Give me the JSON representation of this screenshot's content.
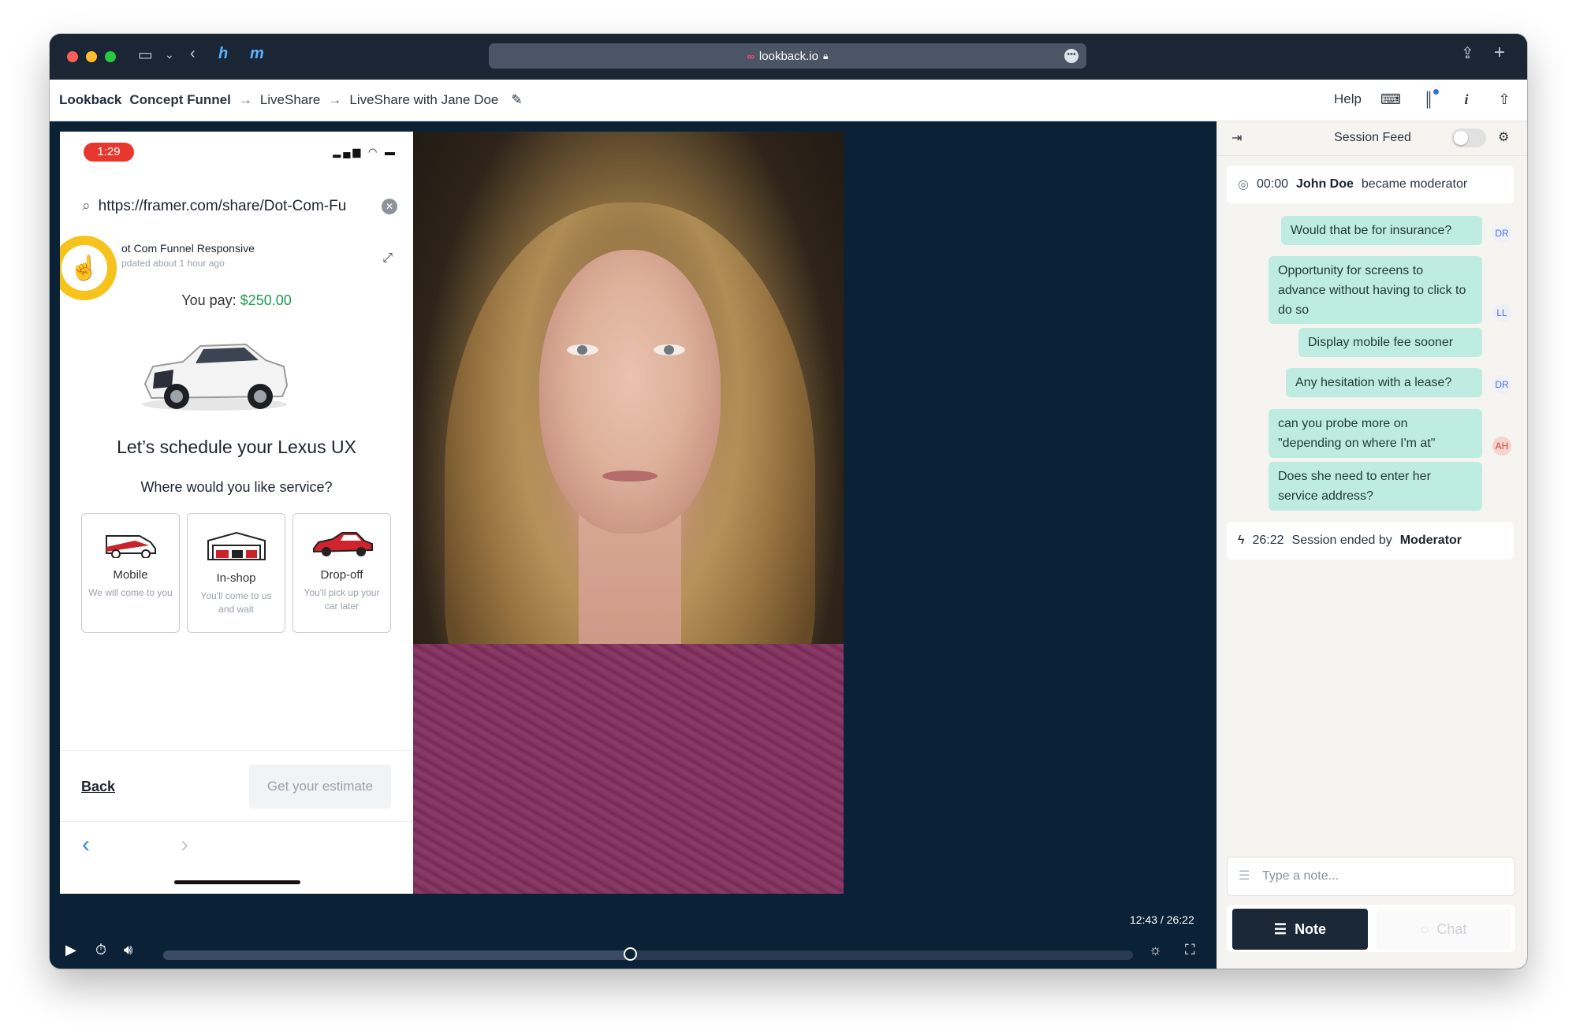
{
  "browser": {
    "url": "lookback.io"
  },
  "header": {
    "brand": "Lookback",
    "breadcrumbs": [
      "Concept Funnel",
      "LiveShare",
      "LiveShare with Jane Doe"
    ],
    "help_label": "Help"
  },
  "phone": {
    "time": "1:29",
    "search_url": "https://framer.com/share/Dot-Com-Fu",
    "project_title": "ot Com Funnel Responsive",
    "project_updated": "pdated about 1 hour ago",
    "you_pay_label": "You pay:",
    "you_pay_amount": "$250.00",
    "schedule_heading": "Let’s schedule your Lexus UX",
    "service_question": "Where would you like service?",
    "options": [
      {
        "title": "Mobile",
        "desc": "We will come to you",
        "icon": "van-icon"
      },
      {
        "title": "In-shop",
        "desc": "You'll come to us and wait",
        "icon": "garage-icon"
      },
      {
        "title": "Drop-off",
        "desc": "You'll pick up your car later",
        "icon": "red-car-icon"
      }
    ],
    "back_label": "Back",
    "estimate_label": "Get your estimate"
  },
  "player": {
    "time_display": "12:43 / 26:22",
    "progress": 0.482
  },
  "feed": {
    "title": "Session Feed",
    "moderator_event": {
      "time": "00:00",
      "name": "John Doe",
      "text": "became moderator"
    },
    "messages": [
      {
        "text": "Would that be for insurance?",
        "initials": "DR"
      },
      {
        "text": "Opportunity for screens to advance without having to click to do so",
        "initials": "LL"
      },
      {
        "text": "Display mobile fee sooner",
        "initials": ""
      },
      {
        "text": "Any hesitation with a lease?",
        "initials": "DR"
      },
      {
        "text": "can you probe more on \"depending on where I'm at\"",
        "initials": "AH"
      },
      {
        "text": "Does she need to enter her service address?",
        "initials": ""
      }
    ],
    "end_event": {
      "time": "26:22",
      "text": "Session ended by",
      "who": "Moderator"
    },
    "note_placeholder": "Type a note...",
    "note_tab": "Note",
    "chat_tab": "Chat"
  }
}
